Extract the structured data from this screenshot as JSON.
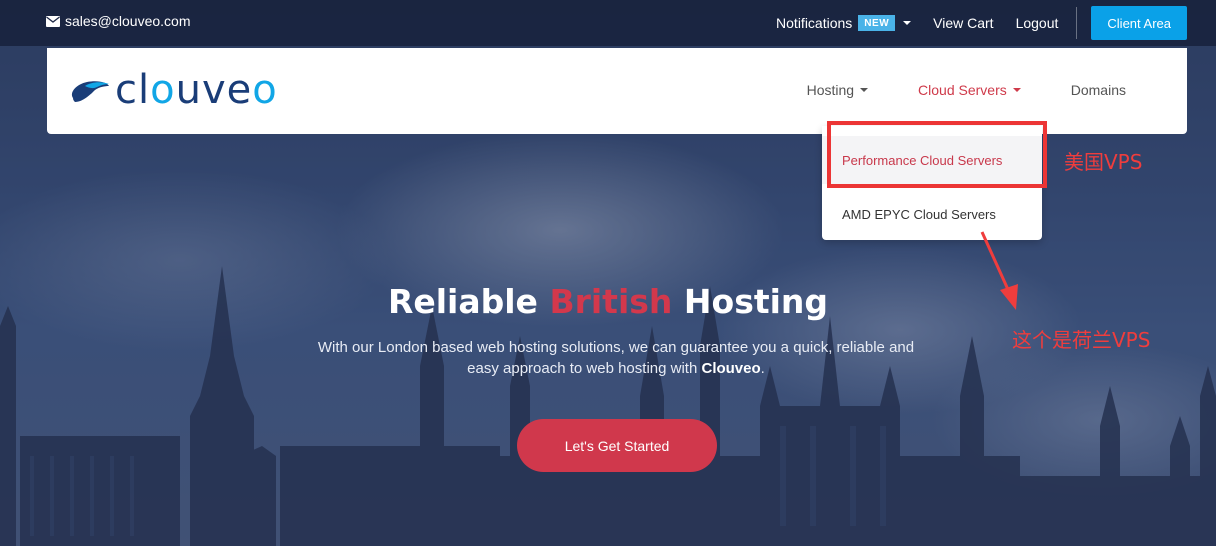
{
  "topbar": {
    "email": "sales@clouveo.com",
    "notifications_label": "Notifications",
    "new_badge": "NEW",
    "view_cart": "View Cart",
    "logout": "Logout",
    "client_area": "Client Area"
  },
  "logo": {
    "text_start": "cl",
    "text_o": "o",
    "text_mid": "uve",
    "text_end": "o"
  },
  "nav": {
    "items": [
      {
        "label": "Hosting"
      },
      {
        "label": "Cloud Servers"
      },
      {
        "label": "Domains"
      }
    ]
  },
  "dropdown": {
    "items": [
      {
        "label": "Performance Cloud Servers"
      },
      {
        "label": "AMD EPYC Cloud Servers"
      }
    ]
  },
  "annotations": {
    "label1": "美国VPS",
    "label2": "这个是荷兰VPS"
  },
  "hero": {
    "title_start": "Reliable",
    "title_accent": "British",
    "title_end": "Hosting",
    "subtitle_start": "With our London based web hosting solutions, we can guarantee you a quick, reliable and easy approach to web hosting with",
    "subtitle_brand": "Clouveo",
    "subtitle_end": ".",
    "cta": "Let's Get Started"
  },
  "colors": {
    "accent_red": "#d0384c",
    "brand_blue": "#1a3d78",
    "brand_cyan": "#11a6e6",
    "client_btn": "#0aa1e8",
    "badge": "#4ab3e8",
    "annotation": "#ef3d3d"
  },
  "icons": {
    "email": "mail-icon",
    "logo": "cloud-logo-icon"
  }
}
